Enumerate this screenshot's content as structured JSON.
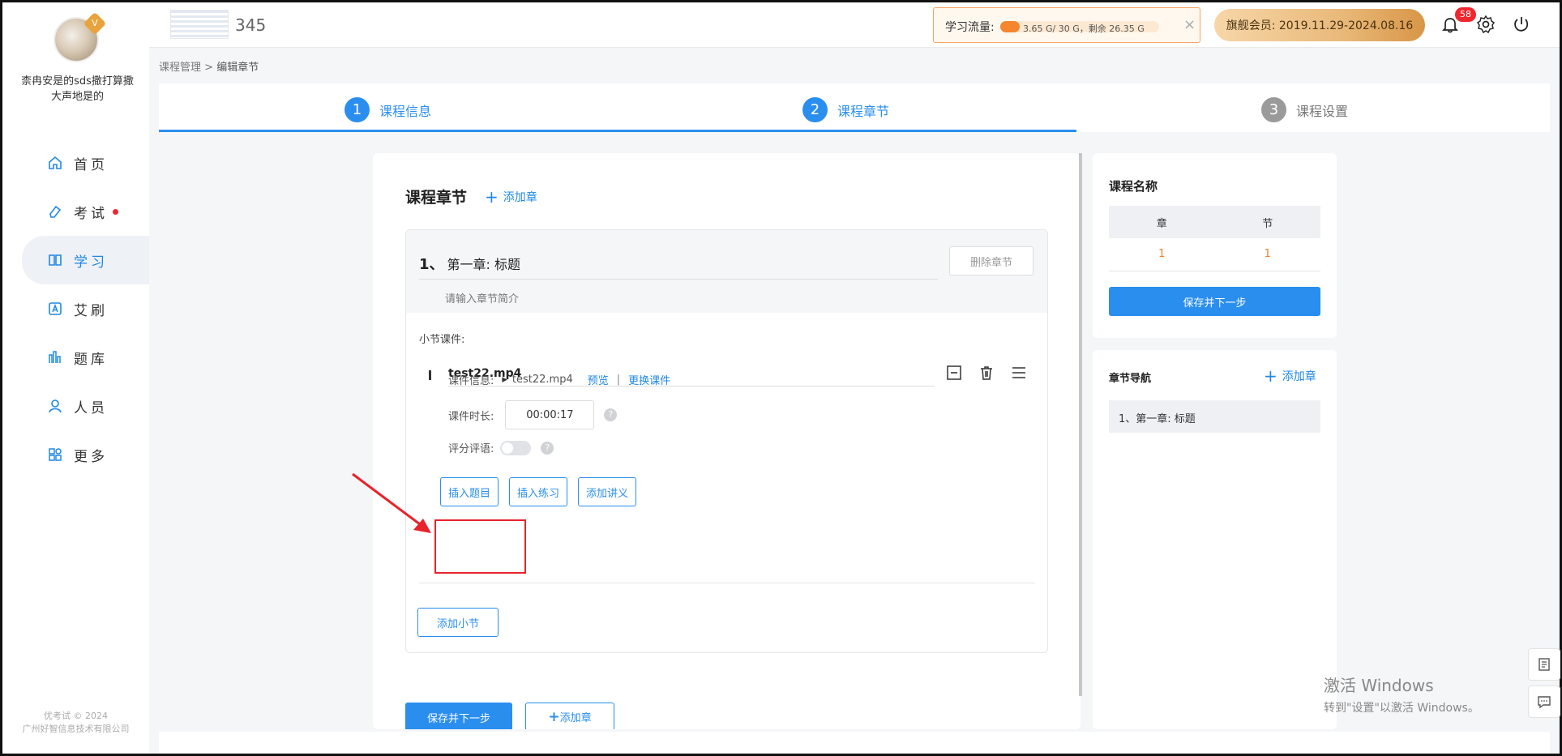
{
  "user": {
    "name": "柰冉安是的sds撒打算撒大声地是的",
    "vip_badge": "V"
  },
  "sidebar": {
    "items": [
      {
        "label": "首页",
        "icon": "home-icon",
        "active": false
      },
      {
        "label": "考试",
        "icon": "eraser-icon",
        "active": false,
        "dot": true
      },
      {
        "label": "学习",
        "icon": "book-icon",
        "active": true
      },
      {
        "label": "艾刷",
        "icon": "letter-a-icon",
        "active": false
      },
      {
        "label": "题库",
        "icon": "bars-icon",
        "active": false
      },
      {
        "label": "人员",
        "icon": "person-icon",
        "active": false
      },
      {
        "label": "更多",
        "icon": "apps-icon",
        "active": false
      }
    ],
    "footer_line1": "优考试 © 2024",
    "footer_line2": "广州好智信息技术有限公司"
  },
  "topbar": {
    "logo_text": "345",
    "traffic_label": "学习流量:",
    "traffic_text": "3.65 G/ 30 G，剩余 26.35 G",
    "traffic_used_fraction": 0.12,
    "member_text": "旗舰会员: 2019.11.29-2024.08.16",
    "notification_count": "58"
  },
  "breadcrumb": {
    "parent": "课程管理",
    "separator": ">",
    "current": "编辑章节"
  },
  "steps": [
    {
      "num": "1",
      "label": "课程信息",
      "active": true
    },
    {
      "num": "2",
      "label": "课程章节",
      "active": true
    },
    {
      "num": "3",
      "label": "课程设置",
      "active": false
    }
  ],
  "main": {
    "section_title": "课程章节",
    "add_chapter_label": "添加章",
    "chapter": {
      "number": "1、",
      "title": "第一章: 标题",
      "delete_label": "删除章节",
      "description_placeholder": "请输入章节简介",
      "section_label": "小节课件:",
      "course_name": "test22.mp4",
      "info_label": "课件信息:",
      "info_file": "test22.mp4",
      "preview_label": "预览",
      "separator": "|",
      "replace_label": "更换课件",
      "duration_label": "课件时长:",
      "duration_value": "00:00:17",
      "comment_label": "评分评语:",
      "insert_question_label": "插入题目",
      "insert_practice_label": "插入练习",
      "add_notes_label": "添加讲义",
      "add_section_label": "添加小节"
    },
    "save_next_label": "保存并下一步",
    "add_chapter_bottom_label": "添加章"
  },
  "summary": {
    "title": "课程名称",
    "headers": [
      "章",
      "节"
    ],
    "values": [
      "1",
      "1"
    ],
    "save_next_label": "保存并下一步"
  },
  "chapter_nav": {
    "title": "章节导航",
    "add_label": "添加章",
    "items": [
      "1、第一章: 标题"
    ]
  },
  "watermark": {
    "line1": "激活 Windows",
    "line2": "转到\"设置\"以激活 Windows。"
  },
  "colors": {
    "accent": "#2a8eef",
    "danger": "#e8232b",
    "orange": "#f5862e"
  }
}
